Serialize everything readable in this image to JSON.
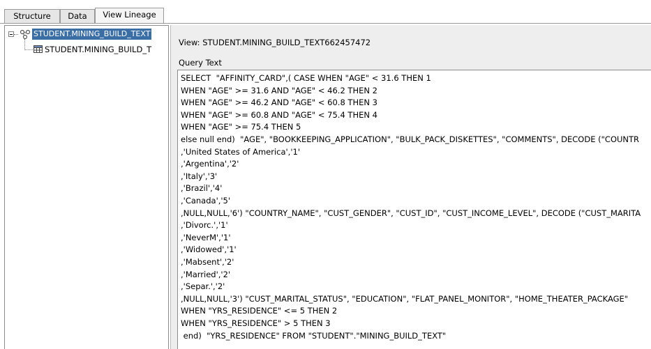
{
  "tabs": [
    {
      "label": "Structure",
      "active": false
    },
    {
      "label": "Data",
      "active": false
    },
    {
      "label": "View Lineage",
      "active": true
    }
  ],
  "tree": {
    "root": {
      "label": "STUDENT.MINING_BUILD_TEXT",
      "icon": "view-icon",
      "selected": true
    },
    "child": {
      "label": "STUDENT.MINING_BUILD_T",
      "icon": "table-icon"
    }
  },
  "view": {
    "label": "View:",
    "name": "STUDENT.MINING_BUILD_TEXT662457472"
  },
  "query": {
    "label": "Query Text",
    "lines": [
      "SELECT  \"AFFINITY_CARD\",( CASE WHEN \"AGE\" < 31.6 THEN 1",
      "WHEN \"AGE\" >= 31.6 AND \"AGE\" < 46.2 THEN 2",
      "WHEN \"AGE\" >= 46.2 AND \"AGE\" < 60.8 THEN 3",
      "WHEN \"AGE\" >= 60.8 AND \"AGE\" < 75.4 THEN 4",
      "WHEN \"AGE\" >= 75.4 THEN 5",
      "else null end)  \"AGE\", \"BOOKKEEPING_APPLICATION\", \"BULK_PACK_DISKETTES\", \"COMMENTS\", DECODE (\"COUNTR",
      ",'United States of America','1'",
      ",'Argentina','2'",
      ",'Italy','3'",
      ",'Brazil','4'",
      ",'Canada','5'",
      ",NULL,NULL,'6') \"COUNTRY_NAME\", \"CUST_GENDER\", \"CUST_ID\", \"CUST_INCOME_LEVEL\", DECODE (\"CUST_MARITA",
      ",'Divorc.','1'",
      ",'NeverM','1'",
      ",'Widowed','1'",
      ",'Mabsent','2'",
      ",'Married','2'",
      ",'Separ.','2'",
      ",NULL,NULL,'3') \"CUST_MARITAL_STATUS\", \"EDUCATION\", \"FLAT_PANEL_MONITOR\", \"HOME_THEATER_PACKAGE\"",
      "WHEN \"YRS_RESIDENCE\" <= 5 THEN 2",
      "WHEN \"YRS_RESIDENCE\" > 5 THEN 3",
      " end)  \"YRS_RESIDENCE\" FROM \"STUDENT\".\"MINING_BUILD_TEXT\""
    ]
  },
  "colors": {
    "selection": "#3a6ea5",
    "selection_text": "#ffffff",
    "panel_bg": "#eeeeee"
  }
}
